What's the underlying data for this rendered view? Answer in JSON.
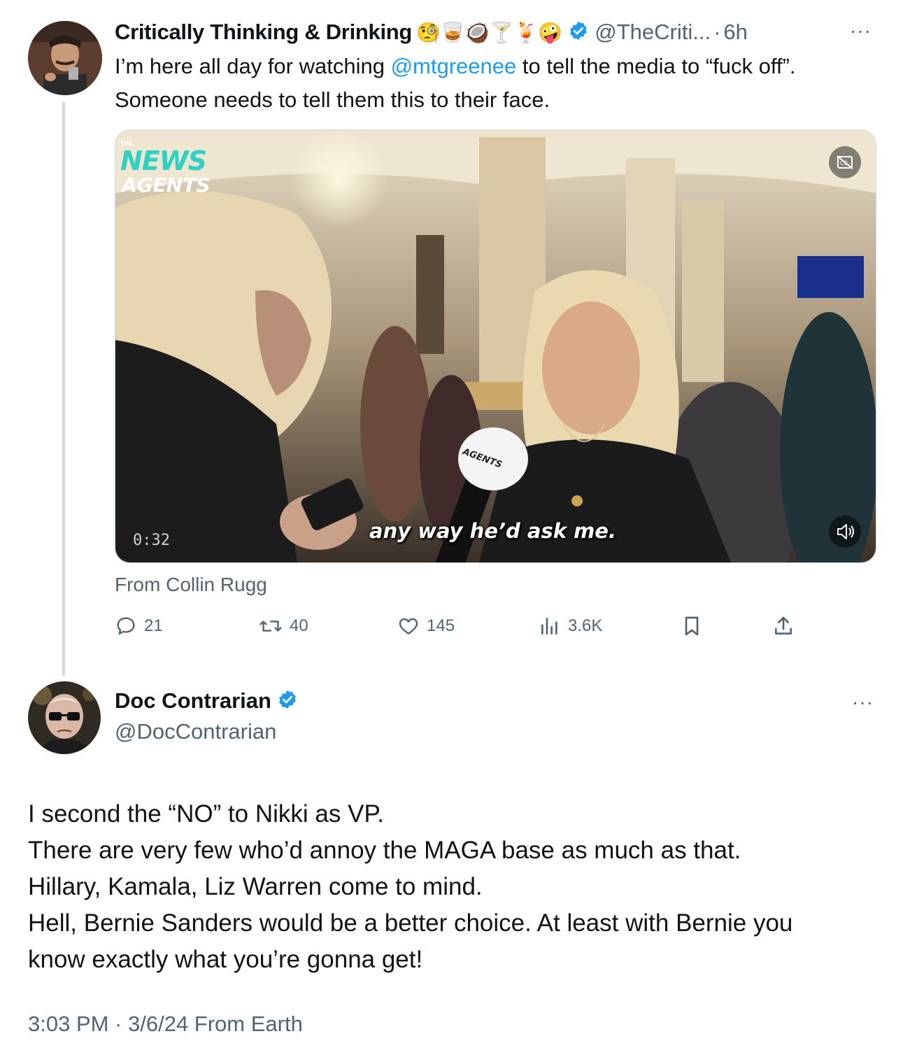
{
  "tweet1": {
    "display_name": "Critically Thinking & Drinking",
    "emojis": "🧐🥃🥥🍸🍹🤪",
    "handle": "@TheCriti...",
    "separator": "·",
    "time": "6h",
    "more": "···",
    "text_before": "I’m here all day for watching ",
    "mention": "@mtgreenee",
    "text_after": " to tell the media to “fuck off”.",
    "text_line2": "Someone needs to tell them this to their face.",
    "video": {
      "logo_the": "THE",
      "logo_news": "NEWS",
      "logo_agents": "AGENTS",
      "mic_label": "AGENTS",
      "caption": "any way he’d ask me.",
      "duration": "0:32"
    },
    "from": "From Collin Rugg",
    "actions": {
      "replies": "21",
      "retweets": "40",
      "likes": "145",
      "views": "3.6K"
    }
  },
  "tweet2": {
    "display_name": "Doc Contrarian",
    "handle": "@DocContrarian",
    "more": "···",
    "lines": [
      "I second the “NO” to Nikki as VP.",
      "There are very few who’d annoy the MAGA base as much as that.",
      "Hillary, Kamala, Liz Warren come to mind.",
      "Hell, Bernie Sanders would be a better choice. At least with Bernie you",
      "know exactly what you’re gonna get!"
    ],
    "timestamp": "3:03 PM · 3/6/24 From Earth"
  },
  "colors": {
    "verified": "#1d9bf0",
    "link": "#1d9bf0",
    "secondary_text": "#536471",
    "thread_line": "#cfd9de"
  }
}
